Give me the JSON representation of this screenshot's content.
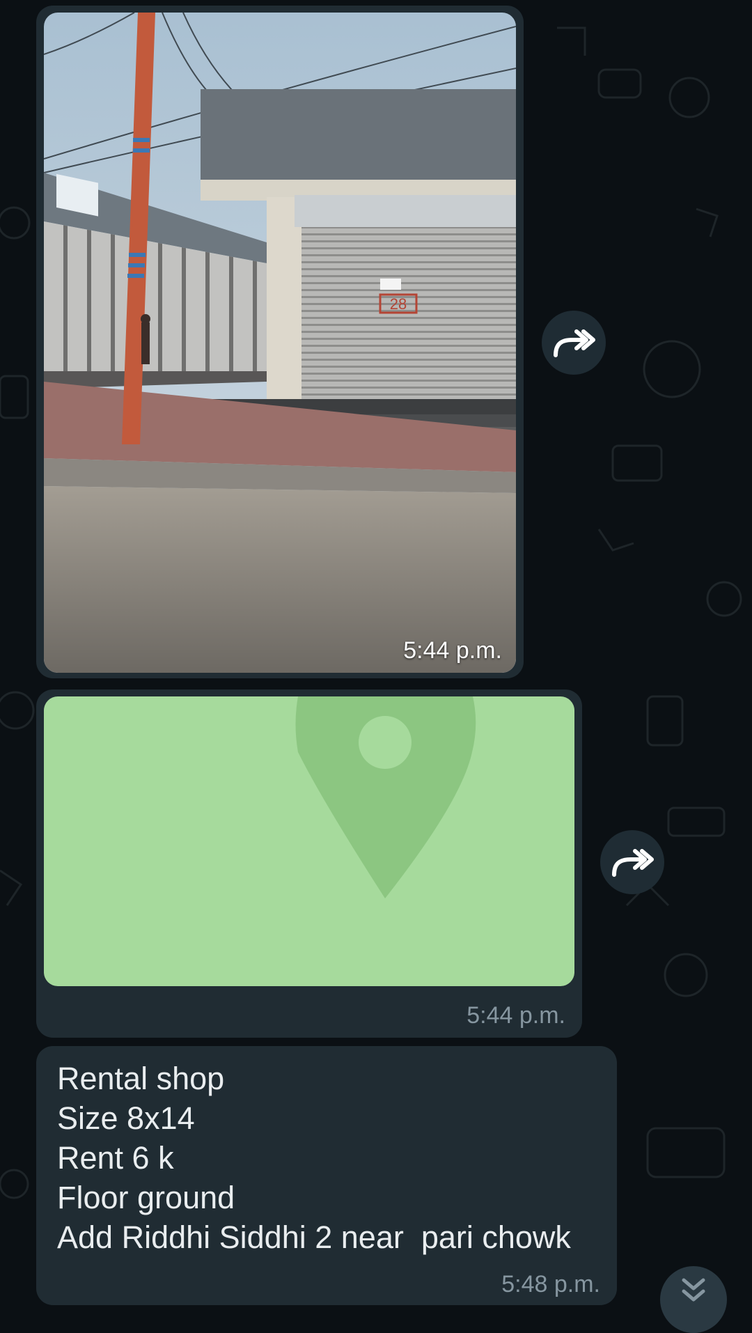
{
  "chat": {
    "messages": [
      {
        "type": "image",
        "time": "5:44 p.m.",
        "photo_sign_text": "28"
      },
      {
        "type": "location",
        "time": "5:44 p.m."
      },
      {
        "type": "text",
        "lines": [
          "Rental shop",
          "Size 8x14",
          "Rent 6 k",
          "Floor ground",
          "Add Riddhi Siddhi 2 near  pari chowk"
        ],
        "time": "5:48 p.m."
      }
    ]
  },
  "icons": {
    "forward": "forward-icon",
    "scroll_down": "double-chevron-down-icon",
    "location_pin": "location-pin-icon"
  },
  "colors": {
    "background": "#0b1014",
    "bubble": "#202c33",
    "map": "#a6da9c",
    "pin": "#8cc681",
    "text": "#e9edef",
    "timestamp": "#8696a0"
  }
}
